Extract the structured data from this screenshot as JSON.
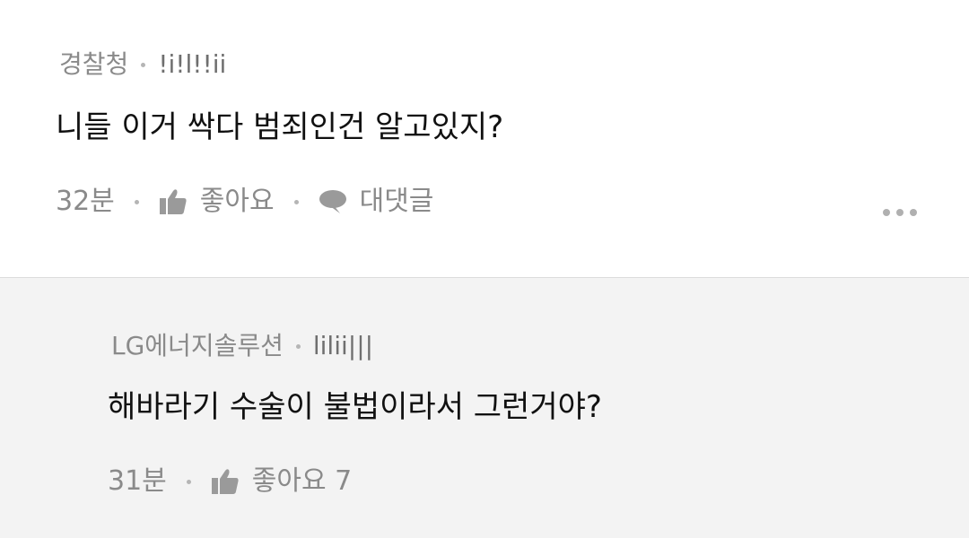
{
  "comments": [
    {
      "author": "경찰청",
      "nickname": "!i!l!!ii",
      "text": "니들 이거 싹다 범죄인건 알고있지?",
      "time": "32분",
      "like_label": "좋아요",
      "reply_label": "대댓글"
    },
    {
      "author": "LG에너지솔루션",
      "nickname": "lilii|||",
      "text": "해바라기 수술이 불법이라서 그런거야?",
      "time": "31분",
      "like_label": "좋아요 7"
    }
  ],
  "icons": {
    "like": "thumbs-up-icon",
    "reply": "speech-bubble-icon",
    "more": "more-dots-icon"
  },
  "colors": {
    "reply_background": "#f3f3f3",
    "meta_text": "#8a8a8a",
    "body_text": "#111111"
  }
}
